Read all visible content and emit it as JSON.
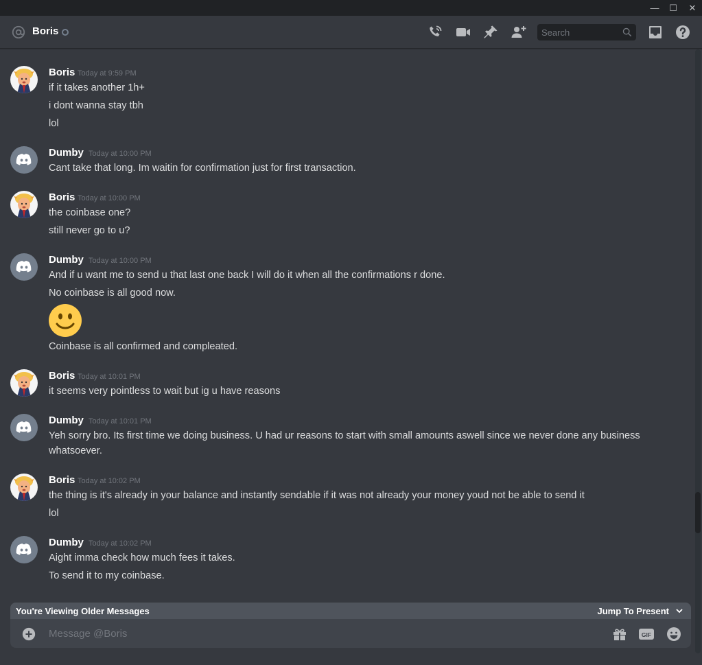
{
  "window": {
    "minimize_glyph": "—",
    "maximize_glyph": "☐",
    "close_glyph": "✕"
  },
  "header": {
    "channel_icon": "at-sign-icon",
    "name": "Boris",
    "status": "offline",
    "search_placeholder": "Search",
    "icons": [
      "phone-call-icon",
      "video-call-icon",
      "pin-icon",
      "add-friend-icon",
      "inbox-icon",
      "help-icon"
    ]
  },
  "messages": [
    {
      "author": "Boris",
      "timestamp": "Today at 9:59 PM",
      "avatar": "boris-avatar",
      "lines": [
        "if it takes another 1h+",
        "i dont wanna stay tbh",
        "lol"
      ]
    },
    {
      "author": "Dumby",
      "timestamp": "Today at 10:00 PM",
      "avatar": "discord-default-avatar",
      "lines": [
        "Cant take that long. Im waitin for confirmation just for first transaction."
      ]
    },
    {
      "author": "Boris",
      "timestamp": "Today at 10:00 PM",
      "avatar": "boris-avatar",
      "lines": [
        "the coinbase one?",
        "still never go to u?"
      ]
    },
    {
      "author": "Dumby",
      "timestamp": "Today at 10:00 PM",
      "avatar": "discord-default-avatar",
      "lines": [
        "And if u want me to send u that last one back I will do it when all the confirmations r done.",
        "No coinbase is all good now.",
        "Coinbase is all confirmed and compleated."
      ],
      "emoji": "slightly-smiling-face-emoji"
    },
    {
      "author": "Boris",
      "timestamp": "Today at 10:01 PM",
      "avatar": "boris-avatar",
      "lines": [
        "it seems very pointless to wait but ig u have reasons"
      ]
    },
    {
      "author": "Dumby",
      "timestamp": "Today at 10:01 PM",
      "avatar": "discord-default-avatar",
      "lines": [
        "Yeh sorry bro. Its first time we doing business. U had ur reasons to start with small amounts aswell since we never done any business whatsoever."
      ]
    },
    {
      "author": "Boris",
      "timestamp": "Today at 10:02 PM",
      "avatar": "boris-avatar",
      "lines": [
        "the thing is it's already in your balance and instantly sendable if it was not already your money youd not be able to send it",
        "lol"
      ]
    },
    {
      "author": "Dumby",
      "timestamp": "Today at 10:02 PM",
      "avatar": "discord-default-avatar",
      "lines": [
        "Aight imma check how much fees it takes.",
        "To send it to my coinbase."
      ]
    }
  ],
  "older_bar": {
    "text": "You're Viewing Older Messages",
    "jump_label": "Jump To Present"
  },
  "composer": {
    "placeholder": "Message @Boris",
    "icons": [
      "add-attachment-icon",
      "gift-icon",
      "gif-icon",
      "emoji-picker-icon"
    ]
  },
  "colors": {
    "background": "#36393f",
    "titlebar": "#202225",
    "composer": "#40444b",
    "older_bar": "#4f545c",
    "discord_blurple_gray": "#747f8d"
  }
}
